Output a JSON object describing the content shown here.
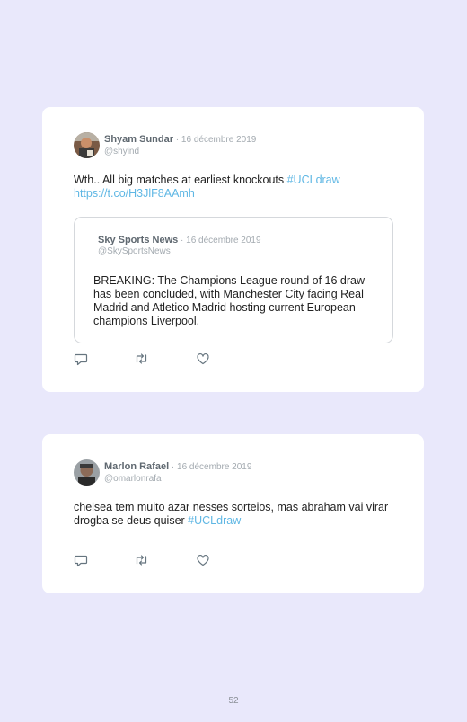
{
  "tweets": [
    {
      "author_name": "Shyam Sundar",
      "date": "16 décembre 2019",
      "handle": "@shyind",
      "text": "Wth.. All big matches at earliest knockouts ",
      "hashtag": "#UCLdraw",
      "link": "https://t.co/H3JlF8AAmh",
      "quote": {
        "author_name": "Sky Sports News",
        "date": "16 décembre 2019",
        "handle": "@SkySportsNews",
        "text": "BREAKING: The Champions League round of 16 draw has been concluded, with Manchester City facing Real Madrid and Atletico Madrid hosting current European champions Liverpool."
      }
    },
    {
      "author_name": "Marlon Rafael",
      "date": "16 décembre 2019",
      "handle": "@omarlonrafa",
      "text": "chelsea tem muito azar nesses sorteios, mas abraham vai virar drogba se deus quiser ",
      "hashtag": "#UCLdraw"
    }
  ],
  "separator": " · ",
  "page_number": "52",
  "icons": {
    "reply": "reply-icon",
    "retweet": "retweet-icon",
    "like": "heart-icon"
  },
  "colors": {
    "background": "#e9e8fb",
    "card": "#ffffff",
    "link": "#5fb7e4",
    "muted": "#a3aab0",
    "name": "#5f6870"
  }
}
